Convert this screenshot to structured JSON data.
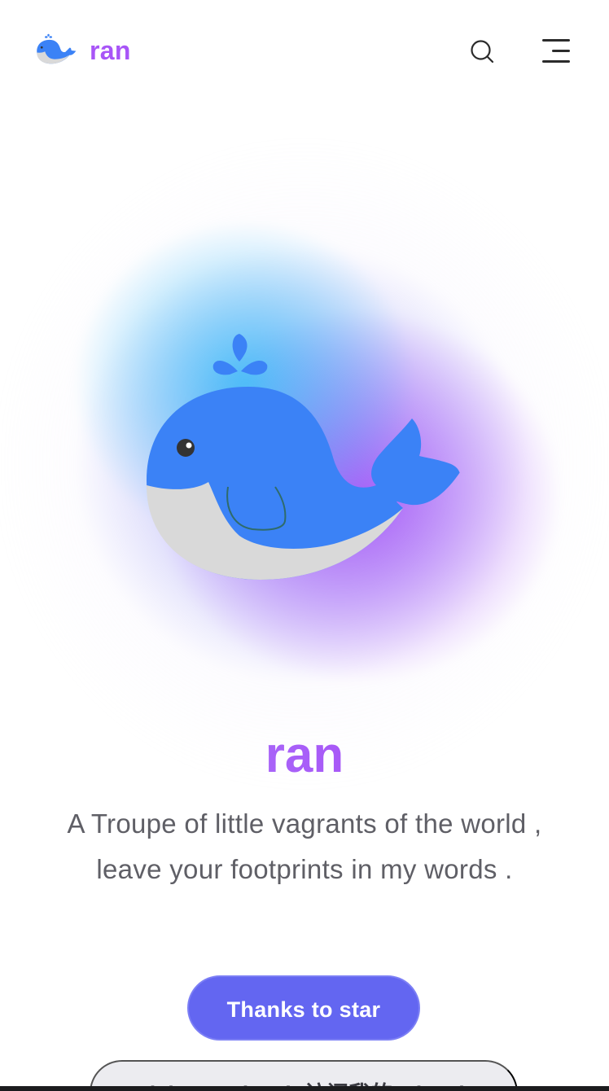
{
  "header": {
    "brand_name": "ran",
    "logo_icon": "whale-icon",
    "search_icon": "search-icon",
    "menu_icon": "menu-icon"
  },
  "hero": {
    "illustration_icon": "whale-illustration",
    "title": "ran",
    "tagline": "A Troupe of little vagrants of the world , leave your footprints in my words ."
  },
  "actions": {
    "primary_label": "Thanks to star",
    "secondary_label": "Visit my GitHub  访问我的 GitHub"
  },
  "colors": {
    "accent": "#a855f7",
    "primary_button": "#6366f1",
    "whale_blue": "#3b82f6",
    "whale_belly": "#d9d9d9",
    "glow_blue": "#38bdf8",
    "glow_purple": "#a855f7"
  }
}
